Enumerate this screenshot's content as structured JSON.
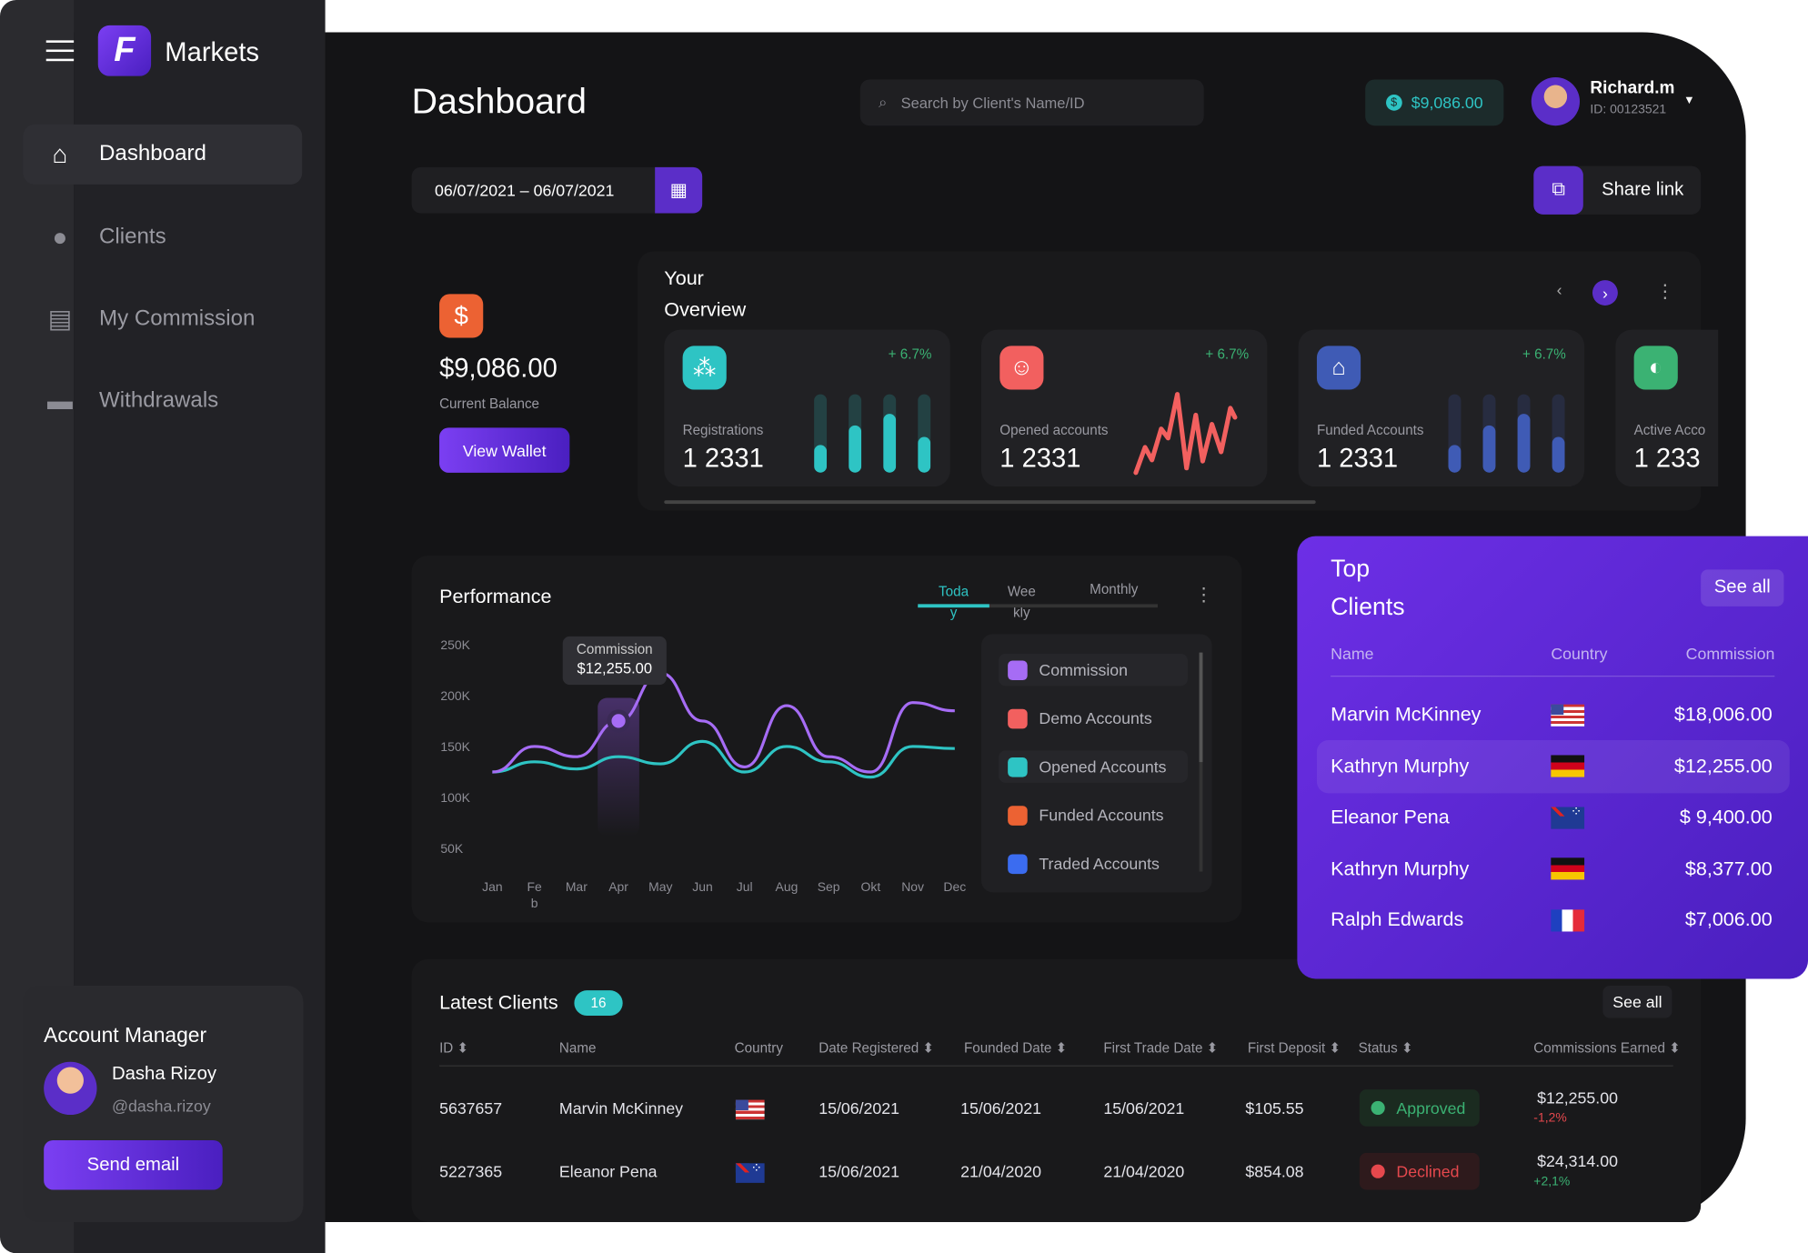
{
  "brand": {
    "name": "Markets"
  },
  "sidebar": {
    "items": [
      {
        "label": "Dashboard",
        "icon": "home-icon",
        "active": true
      },
      {
        "label": "Clients",
        "icon": "user-icon"
      },
      {
        "label": "My Commission",
        "icon": "wallet-icon"
      },
      {
        "label": "Withdrawals",
        "icon": "card-icon"
      }
    ],
    "account_manager": {
      "title": "Account Manager",
      "name": "Dasha Rizoy",
      "handle": "@dasha.rizoy",
      "button": "Send email"
    }
  },
  "header": {
    "title": "Dashboard",
    "search_placeholder": "Search by Client's Name/ID",
    "balance": "$9,086.00",
    "user": {
      "name": "Richard.m",
      "id": "ID: 00123521"
    }
  },
  "date_range": "06/07/2021 – 06/07/2021",
  "share_label": "Share link",
  "wallet": {
    "amount": "$9,086.00",
    "label": "Current Balance",
    "button": "View Wallet"
  },
  "overview": {
    "title_line1": "Your",
    "title_line2": "Overview",
    "cards": [
      {
        "label": "Registrations",
        "value": "1 2331",
        "change": "+ 6.7%",
        "color": "#2ec4c4",
        "bars": [
          0.35,
          0.6,
          0.75,
          0.45
        ]
      },
      {
        "label": "Opened accounts",
        "value": "1 2331",
        "change": "+ 6.7%",
        "color": "#f2605f"
      },
      {
        "label": "Funded Accounts",
        "value": "1 2331",
        "change": "+ 6.7%",
        "color": "#3f5bb5",
        "bars": [
          0.35,
          0.6,
          0.75,
          0.45
        ]
      },
      {
        "label": "Active Acco",
        "value": "1 233",
        "change": "",
        "color": "#3bb273"
      }
    ]
  },
  "performance": {
    "title": "Performance",
    "tabs": [
      "Toda\ny",
      "Wee\nkly",
      "Monthly"
    ],
    "active_tab": 0,
    "tooltip": {
      "label": "Commission",
      "value": "$12,255.00"
    },
    "legend": [
      {
        "label": "Commission",
        "color": "#a66cf5"
      },
      {
        "label": "Demo Accounts",
        "color": "#f2605f"
      },
      {
        "label": "Opened Accounts",
        "color": "#2ec4c4"
      },
      {
        "label": "Funded Accounts",
        "color": "#ec6233"
      },
      {
        "label": "Traded Accounts",
        "color": "#3b6cf0"
      }
    ]
  },
  "chart_data": {
    "type": "line",
    "categories": [
      "Jan",
      "Fe\nb",
      "Mar",
      "Apr",
      "May",
      "Jun",
      "Jul",
      "Aug",
      "Sep",
      "Okt",
      "Nov",
      "Dec"
    ],
    "yticks": [
      "250K",
      "200K",
      "150K",
      "100K",
      "50K"
    ],
    "ylim": [
      50000,
      250000
    ],
    "series": [
      {
        "name": "Commission",
        "color": "#a66cf5",
        "values": [
          125000,
          150000,
          140000,
          175000,
          222000,
          175000,
          130000,
          190000,
          140000,
          125000,
          193000,
          185000
        ]
      },
      {
        "name": "Opened Accounts",
        "color": "#2ec4c4",
        "values": [
          125000,
          135000,
          128000,
          140000,
          133000,
          155000,
          125000,
          150000,
          135000,
          120000,
          150000,
          148000
        ]
      }
    ]
  },
  "top_clients": {
    "title_line1": "Top",
    "title_line2": "Clients",
    "see_all": "See all",
    "columns": [
      "Name",
      "Country",
      "Commission"
    ],
    "rows": [
      {
        "name": "Marvin McKinney",
        "flag": "us",
        "commission": "$18,006.00"
      },
      {
        "name": "Kathryn Murphy",
        "flag": "de",
        "commission": "$12,255.00"
      },
      {
        "name": "Eleanor Pena",
        "flag": "au",
        "commission": "$ 9,400.00"
      },
      {
        "name": "Kathryn Murphy",
        "flag": "de",
        "commission": "$8,377.00"
      },
      {
        "name": "Ralph Edwards",
        "flag": "fr",
        "commission": "$7,006.00"
      }
    ]
  },
  "latest_clients": {
    "title": "Latest Clients",
    "count": "16",
    "see_all": "See all",
    "columns": [
      "ID ⬍",
      "Name",
      "Country",
      "Date Registered ⬍",
      "Founded Date ⬍",
      "First Trade Date ⬍",
      "First Deposit ⬍",
      "Status ⬍",
      "Commissions Earned ⬍"
    ],
    "rows": [
      {
        "id": "5637657",
        "name": "Marvin McKinney",
        "flag": "us",
        "registered": "15/06/2021",
        "founded": "15/06/2021",
        "first_trade": "15/06/2021",
        "deposit": "$105.55",
        "status": "Approved",
        "commission": "$12,255.00",
        "change": "-1,2%"
      },
      {
        "id": "5227365",
        "name": "Eleanor Pena",
        "flag": "au",
        "registered": "15/06/2021",
        "founded": "21/04/2020",
        "first_trade": "21/04/2020",
        "deposit": "$854.08",
        "status": "Declined",
        "commission": "$24,314.00",
        "change": "+2,1%"
      }
    ]
  }
}
